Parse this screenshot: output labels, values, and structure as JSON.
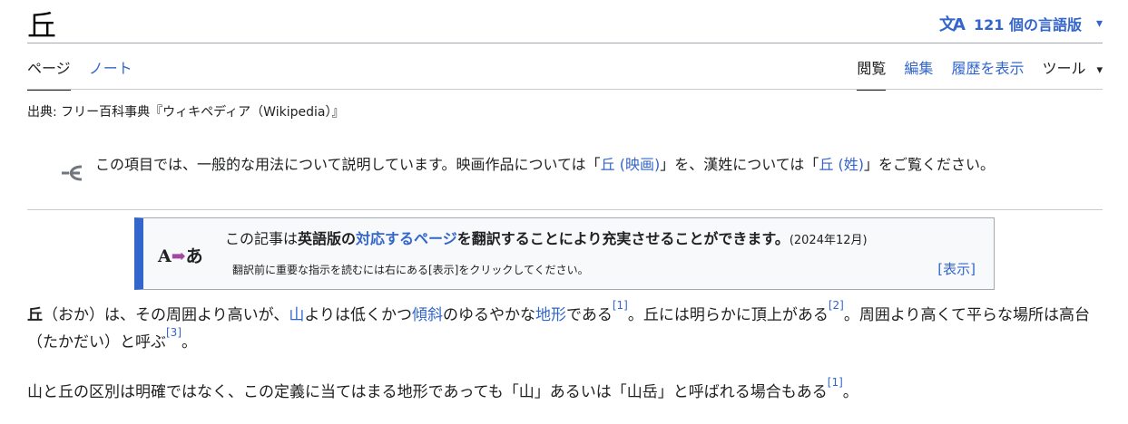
{
  "title": "丘",
  "lang_button": {
    "icon": "translate-icon",
    "label": "121 個の言語版",
    "chevron": "chevron-down-icon"
  },
  "tabs_left": [
    {
      "label": "ページ"
    },
    {
      "label": "ノート"
    }
  ],
  "tabs_right": [
    {
      "label": "閲覧"
    },
    {
      "label": "編集"
    },
    {
      "label": "履歴を表示"
    },
    {
      "label": "ツール"
    }
  ],
  "source": "出典: フリー百科事典『ウィキペディア（Wikipedia）』",
  "hatnote": {
    "icon": "disambiguation-icon",
    "t1": "この項目では、一般的な用法について説明しています。映画作品については「",
    "l1": "丘 (映画)",
    "t2": "」を、漢姓については「",
    "l2": "丘 (姓)",
    "t3": "」をご覧ください。"
  },
  "ambox": {
    "icon_a": "A",
    "icon_arrow": "➡",
    "icon_b": "あ",
    "t1": "この記事は",
    "b1": "英語版の",
    "l1": "対応するページ",
    "b2": "を翻訳することにより充実させることができます。",
    "date": "(2024年12月)",
    "sub": "翻訳前に重要な指示を読むには右にある[表示]をクリックしてください。",
    "show": "[表示]"
  },
  "p1": {
    "b": "丘",
    "t1": "（おか）は、その周囲より高いが、",
    "l1": "山",
    "t2": "よりは低くかつ",
    "l2": "傾斜",
    "t3": "のゆるやかな",
    "l3": "地形",
    "t4": "である",
    "r1": "[1]",
    "t5": "。丘には明らかに頂上がある",
    "r2": "[2]",
    "t6": "。周囲より高くて平らな場所は高台（たかだい）と呼ぶ",
    "r3": "[3]",
    "t7": "。"
  },
  "p2": {
    "t1": "山と丘の区別は明確ではなく、この定義に当てはまる地形であっても「山」あるいは「山岳」と呼ばれる場合もある",
    "r1": "[1]",
    "t2": "。"
  }
}
